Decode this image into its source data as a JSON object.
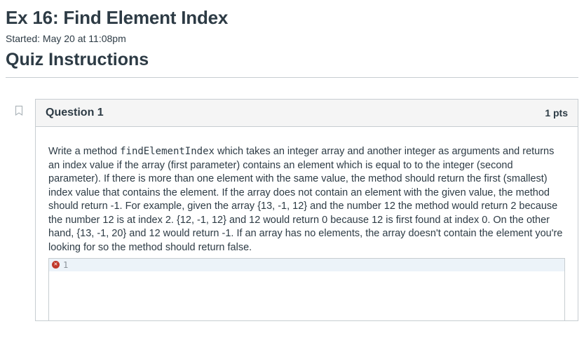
{
  "page": {
    "title": "Ex 16: Find Element Index",
    "started": "Started: May 20 at 11:08pm",
    "instructions_heading": "Quiz Instructions"
  },
  "question": {
    "label": "Question 1",
    "points": "1 pts",
    "prompt_pre": "Write a method ",
    "prompt_code": "findElementIndex",
    "prompt_post": " which takes an integer array and another integer as arguments and returns an index value if the array (first parameter) contains an element which is equal to to the integer (second parameter). If there is more than one element with the same value, the method should return the first (smallest) index value that contains the element. If the array does not contain an element with the given value, the method should return -1. For example, given the array {13, -1, 12} and the number 12 the method would return 2 because the number 12 is at index 2. {12, -1, 12} and 12 would return 0 because 12 is first found at index 0. On the other hand, {13, -1, 20} and 12 would return -1. If an array has no elements, the array doesn't contain the element you're looking for so the method should return false."
  },
  "editor": {
    "line_number": "1",
    "error_glyph": "✕"
  }
}
